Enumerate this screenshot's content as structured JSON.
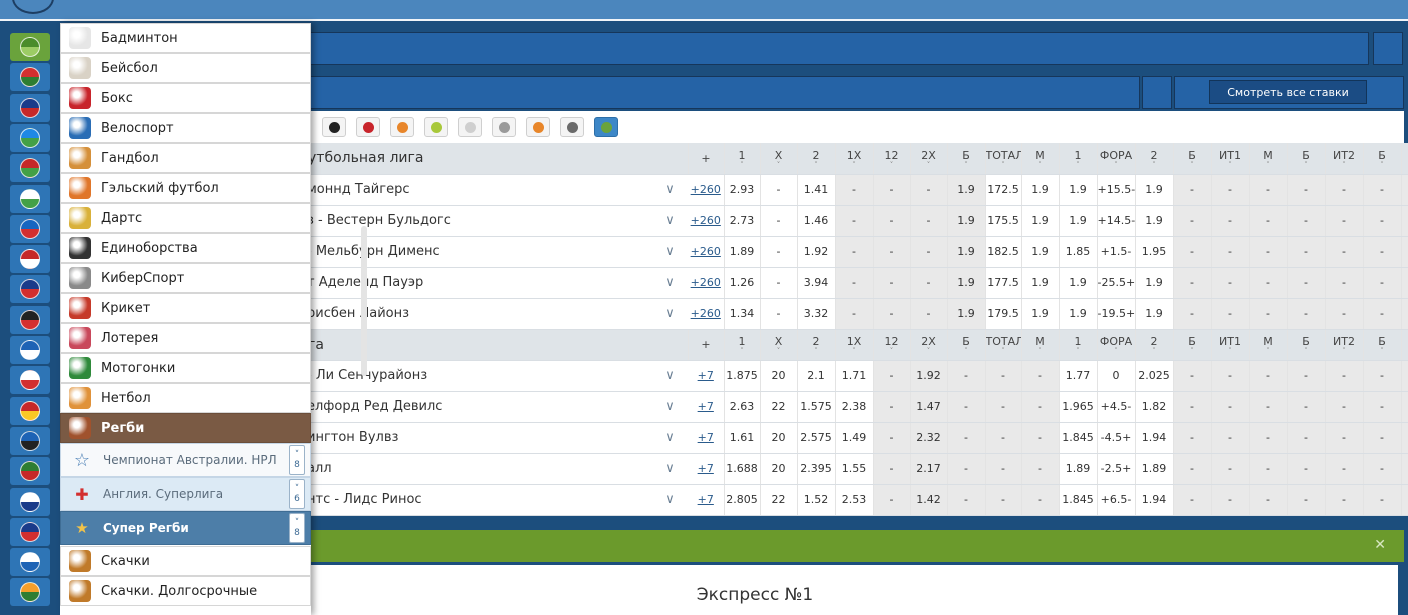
{
  "menu": {
    "items": [
      {
        "label": "Бадминтон",
        "icon": "shuttlecock-icon",
        "color": "#e6e6e6"
      },
      {
        "label": "Бейсбол",
        "icon": "baseball-icon",
        "color": "#d9d2c6"
      },
      {
        "label": "Бокс",
        "icon": "boxing-glove-icon",
        "color": "#c8242b"
      },
      {
        "label": "Велоспорт",
        "icon": "bike-helmet-icon",
        "color": "#2a6db5"
      },
      {
        "label": "Гандбол",
        "icon": "handball-icon",
        "color": "#d5903a"
      },
      {
        "label": "Гэльский футбол",
        "icon": "gaelic-ball-icon",
        "color": "#e0762a"
      },
      {
        "label": "Дартс",
        "icon": "darts-icon",
        "color": "#d9b13a"
      },
      {
        "label": "Единоборства",
        "icon": "yin-yang-icon",
        "color": "#333333"
      },
      {
        "label": "КиберСпорт",
        "icon": "gamepad-icon",
        "color": "#8a8a8a"
      },
      {
        "label": "Крикет",
        "icon": "cricket-icon",
        "color": "#c63a2a"
      },
      {
        "label": "Лотерея",
        "icon": "lottery-icon",
        "color": "#c9485b"
      },
      {
        "label": "Мотогонки",
        "icon": "moto-helmet-icon",
        "color": "#2f8a3b"
      },
      {
        "label": "Нетбол",
        "icon": "netball-hoop-icon",
        "color": "#e0923a"
      },
      {
        "label": "Регби",
        "icon": "rugby-ball-icon",
        "color": "#a0522d"
      }
    ],
    "subitems": [
      {
        "label": "Чемпионат Австралии. НРЛ",
        "icon": "star-icon",
        "count": "8"
      },
      {
        "label": "Англия. Суперлига",
        "icon": "england-flag-icon",
        "count": "6"
      },
      {
        "label": "Супер Регби",
        "icon": "trophy-icon",
        "count": "8"
      }
    ],
    "after": [
      {
        "label": "Скачки",
        "icon": "horse-racing-icon",
        "color": "#c07a2a"
      },
      {
        "label": "Скачки. Долгосрочные",
        "icon": "horse-racing-long-icon",
        "color": "#c07a2a"
      }
    ]
  },
  "flags": [
    "globe",
    "uae",
    "australia",
    "azerbaijan",
    "belarus",
    "bulgaria",
    "czech",
    "denmark",
    "usa",
    "germany",
    "greece",
    "england",
    "spain",
    "estonia",
    "iran",
    "finland",
    "france",
    "israel",
    "india"
  ],
  "header": {
    "all_bets_label": "Смотреть все ставки"
  },
  "columns": [
    "+",
    "1",
    "X",
    "2",
    "1X",
    "12",
    "2X",
    "Б",
    "ТОТАЛ",
    "М",
    "1",
    "ФОРА",
    "2",
    "Б",
    "ИТ1",
    "М",
    "Б",
    "ИТ2",
    "Б"
  ],
  "leagues": [
    {
      "name": "утбольная лига",
      "matches": [
        {
          "teams": "моннд Тайгерс",
          "more": "+260",
          "odds": [
            "2.93",
            "-",
            "1.41",
            "-",
            "-",
            "-",
            "1.9",
            "172.5",
            "1.9",
            "1.9",
            "+15.5-",
            "1.9",
            "-",
            "-",
            "-",
            "-",
            "-",
            "-"
          ]
        },
        {
          "teams": "з - Вестерн Бульдогс",
          "more": "+260",
          "odds": [
            "2.73",
            "-",
            "1.46",
            "-",
            "-",
            "-",
            "1.9",
            "175.5",
            "1.9",
            "1.9",
            "+14.5-",
            "1.9",
            "-",
            "-",
            "-",
            "-",
            "-",
            "-"
          ]
        },
        {
          "teams": "- Мельбурн Дименс",
          "more": "+260",
          "odds": [
            "1.89",
            "-",
            "1.92",
            "-",
            "-",
            "-",
            "1.9",
            "182.5",
            "1.9",
            "1.85",
            "+1.5-",
            "1.95",
            "-",
            "-",
            "-",
            "-",
            "-",
            "-"
          ]
        },
        {
          "teams": "т Аделейд Пауэр",
          "more": "+260",
          "odds": [
            "1.26",
            "-",
            "3.94",
            "-",
            "-",
            "-",
            "1.9",
            "177.5",
            "1.9",
            "1.9",
            "-25.5+",
            "1.9",
            "-",
            "-",
            "-",
            "-",
            "-",
            "-"
          ]
        },
        {
          "teams": "рисбен Лайонз",
          "more": "+260",
          "odds": [
            "1.34",
            "-",
            "3.32",
            "-",
            "-",
            "-",
            "1.9",
            "179.5",
            "1.9",
            "1.9",
            "-19.5+",
            "1.9",
            "-",
            "-",
            "-",
            "-",
            "-",
            "-"
          ]
        }
      ]
    },
    {
      "name": "га",
      "matches": [
        {
          "teams": "- Ли Сенчурайонз",
          "more": "+7",
          "odds": [
            "1.875",
            "20",
            "2.1",
            "1.71",
            "-",
            "1.92",
            "-",
            "-",
            "-",
            "1.77",
            "0",
            "2.025",
            "-",
            "-",
            "-",
            "-",
            "-",
            "-"
          ]
        },
        {
          "teams": "елфорд Ред Девилс",
          "more": "+7",
          "odds": [
            "2.63",
            "22",
            "1.575",
            "2.38",
            "-",
            "1.47",
            "-",
            "-",
            "-",
            "1.965",
            "+4.5-",
            "1.82",
            "-",
            "-",
            "-",
            "-",
            "-",
            "-"
          ]
        },
        {
          "teams": "ингтон Вулвз",
          "more": "+7",
          "odds": [
            "1.61",
            "20",
            "2.575",
            "1.49",
            "-",
            "2.32",
            "-",
            "-",
            "-",
            "1.845",
            "-4.5+",
            "1.94",
            "-",
            "-",
            "-",
            "-",
            "-",
            "-"
          ]
        },
        {
          "teams": "алл",
          "more": "+7",
          "odds": [
            "1.688",
            "20",
            "2.395",
            "1.55",
            "-",
            "2.17",
            "-",
            "-",
            "-",
            "1.89",
            "-2.5+",
            "1.89",
            "-",
            "-",
            "-",
            "-",
            "-",
            "-"
          ]
        },
        {
          "teams": "нтс - Лидс Ринос",
          "more": "+7",
          "odds": [
            "2.805",
            "22",
            "1.52",
            "2.53",
            "-",
            "1.42",
            "-",
            "-",
            "-",
            "1.845",
            "+6.5-",
            "1.94",
            "-",
            "-",
            "-",
            "-",
            "-",
            "-"
          ]
        }
      ]
    }
  ],
  "sport_strip": [
    "tyre-icon",
    "boxing-icon",
    "basketball-icon",
    "tennis-icon",
    "volleyball-icon",
    "bowling-icon",
    "waterpolo-icon",
    "esports-icon",
    "rugby-icon"
  ],
  "coupon": {
    "close_label": "✕",
    "express_title": "Экспресс №1"
  }
}
